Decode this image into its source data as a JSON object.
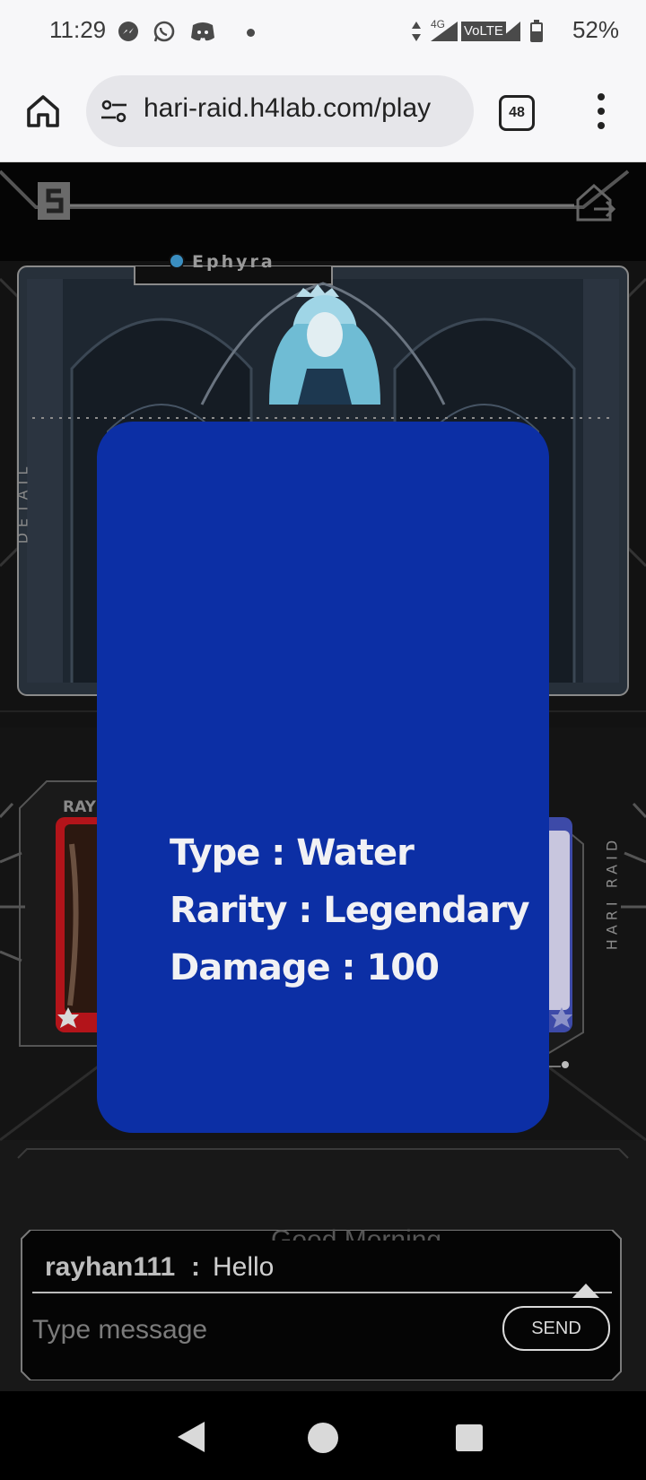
{
  "status_bar": {
    "time": "11:29",
    "network": "4G",
    "volte": "VoLTE",
    "battery": "52%",
    "notification_icons": [
      "messenger-icon",
      "whatsapp-icon",
      "discord-icon",
      "dot-icon"
    ]
  },
  "browser": {
    "url": "hari-raid.h4lab.com/play",
    "tab_count": "48"
  },
  "game": {
    "boss_name": "Ephyra",
    "left_side_label": "DETAIL",
    "right_side_label": "HARI RAID",
    "player_card_label": "RAYI"
  },
  "modal": {
    "type_line": "Type : Water",
    "rarity_line": "Rarity : Legendary",
    "damage_line": "Damage : 100"
  },
  "chat": {
    "previous_message": "Good Morning",
    "last_user": "rayhan111",
    "separator": ":",
    "last_message": "Hello",
    "input_placeholder": "Type message",
    "send_label": "SEND"
  },
  "colors": {
    "modal_bg": "#0c2fa5",
    "game_bg": "#111111"
  }
}
